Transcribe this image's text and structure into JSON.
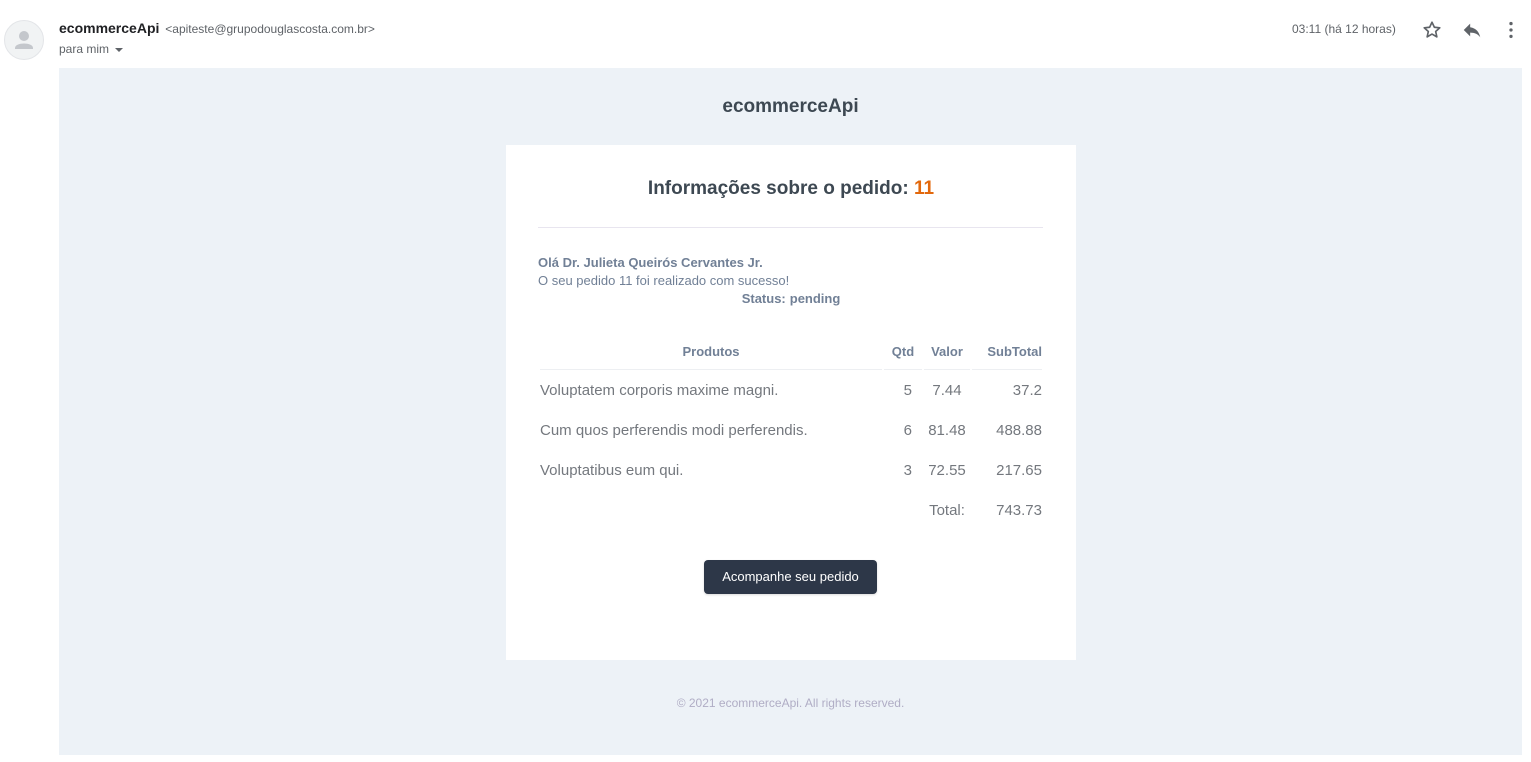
{
  "header": {
    "sender_name": "ecommerceApi",
    "sender_email": "<apiteste@grupodouglascosta.com.br>",
    "recipient": "para mim",
    "date": "03:11 (há 12 horas)",
    "icons": [
      "avatar-icon",
      "star-icon",
      "reply-icon",
      "more-vert-icon"
    ]
  },
  "email": {
    "brand": "ecommerceApi",
    "title_prefix": "Informações sobre o pedido:",
    "order_number": "11",
    "greeting": "Olá Dr. Julieta Queirós Cervantes Jr.",
    "message": "O seu pedido 11 foi realizado com sucesso!",
    "status_label": "Status:",
    "status_value": "pending",
    "table": {
      "headers": {
        "product": "Produtos",
        "qty": "Qtd",
        "value": "Valor",
        "subtotal": "SubTotal"
      },
      "rows": [
        {
          "product": "Voluptatem corporis maxime magni.",
          "qty": "5",
          "value": "7.44",
          "subtotal": "37.2"
        },
        {
          "product": "Cum quos perferendis modi perferendis.",
          "qty": "6",
          "value": "81.48",
          "subtotal": "488.88"
        },
        {
          "product": "Voluptatibus eum qui.",
          "qty": "3",
          "value": "72.55",
          "subtotal": "217.65"
        }
      ],
      "total_label": "Total:",
      "total_value": "743.73"
    },
    "button_label": "Acompanhe seu pedido",
    "footer": "© 2021 ecommerceApi. All rights reserved."
  },
  "colors": {
    "accent_order_number": "#e2680c",
    "button_bg": "#2d3748",
    "email_bg": "#edf2f7"
  }
}
